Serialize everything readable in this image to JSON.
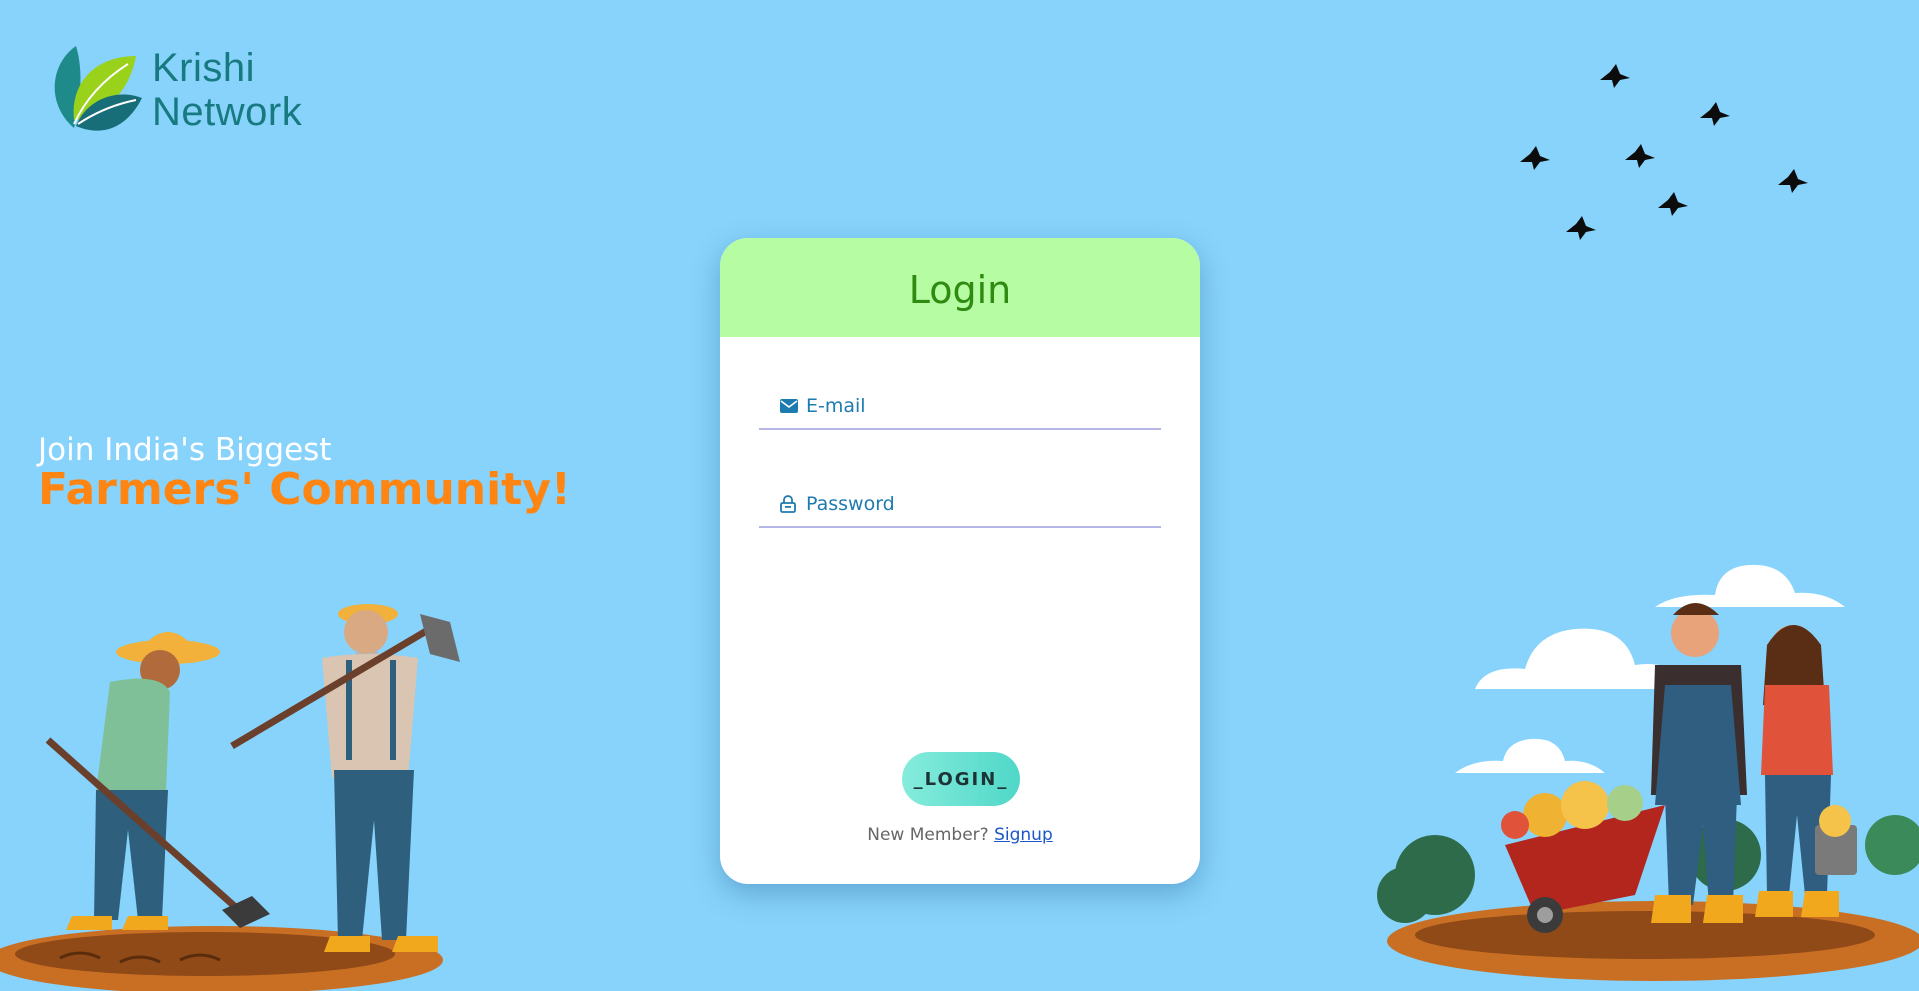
{
  "app": {
    "brand_line1": "Krishi",
    "brand_line2": "Network",
    "brand_color": "#177a80"
  },
  "hero": {
    "line1": "Join India's Biggest",
    "line2": "Farmers' Community!",
    "line2_color": "#ff8513"
  },
  "login": {
    "title": "Login",
    "email_placeholder": "E-mail",
    "password_placeholder": "Password",
    "button_label": "_LOGIN_",
    "signup_prompt": "New Member?",
    "signup_link": "Signup",
    "header_color": "#b5fca3",
    "title_color": "#2f8a10"
  },
  "icons": {
    "email": "envelope-icon",
    "password": "lock-icon",
    "logo": "leaf-logo-icon"
  },
  "colors": {
    "background": "#87d3fb",
    "button_gradient_start": "#86ecdc",
    "button_gradient_end": "#4fd7c8"
  }
}
